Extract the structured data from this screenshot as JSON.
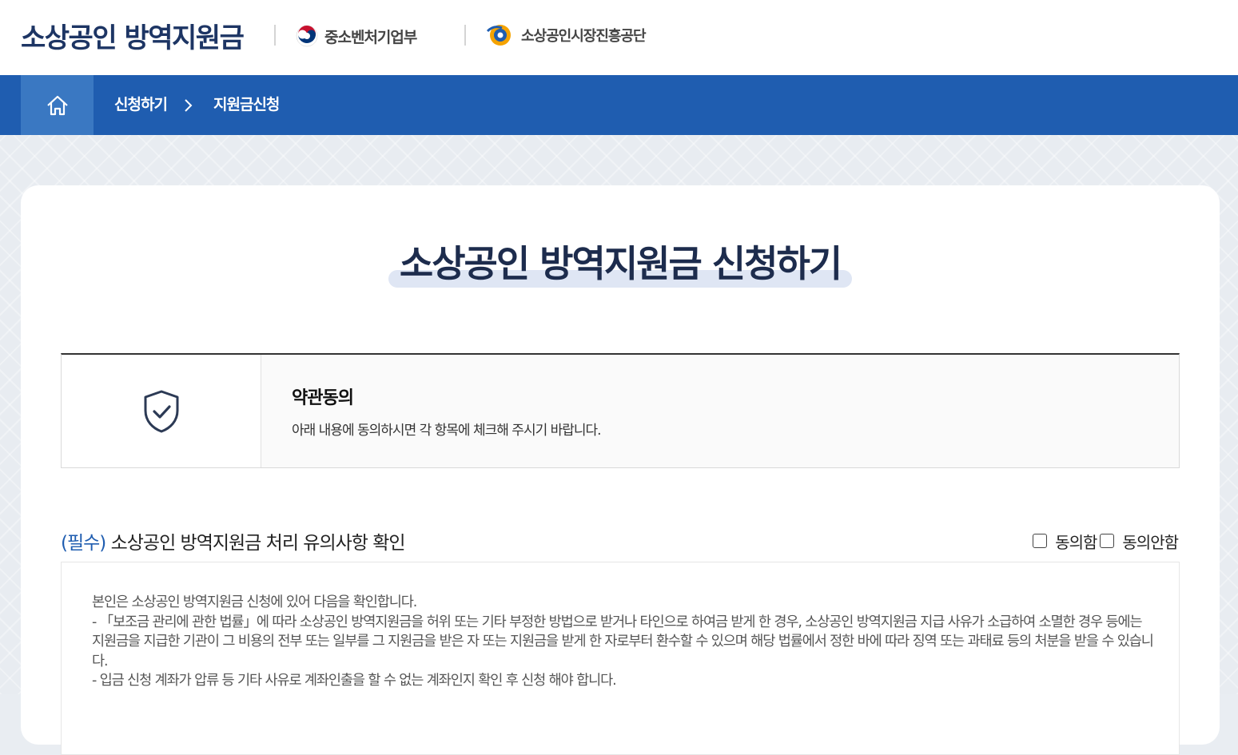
{
  "header": {
    "brand_title": "소상공인 방역지원금",
    "ministry_name": "중소벤처기업부",
    "agency_name": "소상공인시장진흥공단"
  },
  "nav": {
    "home_icon": "home-icon",
    "breadcrumb_1": "신청하기",
    "breadcrumb_2": "지원금신청"
  },
  "main": {
    "page_title": "소상공인 방역지원금 신청하기",
    "terms": {
      "icon": "shield-check-icon",
      "heading": "약관동의",
      "description": "아래 내용에 동의하시면 각 항목에 체크해 주시기 바랍니다."
    },
    "section": {
      "required_tag": "(필수)",
      "title": " 소상공인 방역지원금 처리 유의사항 확인",
      "agree_label": "동의함",
      "disagree_label": "동의안함"
    },
    "notice_lines": [
      "본인은 소상공인 방역지원금 신청에 있어 다음을 확인합니다.",
      "- 「보조금 관리에 관한 법률」에 따라 소상공인 방역지원금을 허위 또는 기타 부정한 방법으로 받거나 타인으로 하여금 받게 한 경우, 소상공인 방역지원금 지급 사유가 소급하여 소멸한 경우 등에는 지원금을 지급한 기관이 그 비용의 전부 또는 일부를 그 지원금을 받은 자 또는 지원금을 받게 한 자로부터 환수할 수 있으며 해당 법률에서 정한 바에 따라 징역 또는 과태료 등의 처분을 받을 수 있습니다.",
      "- 입금 신청 계좌가 압류 등 기타 사유로 계좌인출을 할 수 없는 계좌인지 확인 후 신청 해야 합니다."
    ]
  },
  "colors": {
    "primary_blue": "#1f5db0",
    "home_button_blue": "#3a78c2",
    "title_navy": "#1d2c4d"
  }
}
